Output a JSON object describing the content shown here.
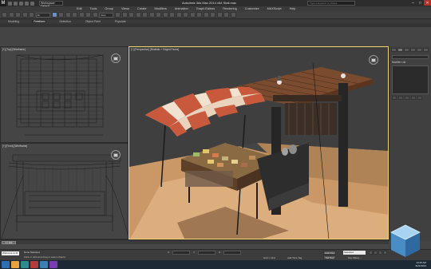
{
  "titlebar": {
    "app_title": "Autodesk 3ds Max  2014 x64      Stall.max",
    "workspace": "Workspace: Default",
    "search_placeholder": "Type a keyword or phrase",
    "min": "–",
    "max": "□",
    "close": "✕"
  },
  "menu": [
    "Edit",
    "Tools",
    "Group",
    "Views",
    "Create",
    "Modifiers",
    "Animation",
    "Graph Editors",
    "Rendering",
    "Customize",
    "MAXScript",
    "Help"
  ],
  "toolbar": {
    "selection_filter": "All",
    "view_dropdown": "View"
  },
  "ribbon": {
    "tabs": [
      "Modeling",
      "Freeform",
      "Selection",
      "Object Paint",
      "Populate"
    ]
  },
  "viewports": {
    "top_label": "[+] [Top] [Wireframe]",
    "front_label": "[+] [Front] [Wireframe]",
    "persp_label": "[+] [Perspective] [Realistic + Edged Faces]"
  },
  "command_panel": {
    "section_label": "Modifier List"
  },
  "timeline": {
    "slider_text": "0 / 100"
  },
  "status": {
    "maxscript": "Welcome to M",
    "message": "None Selected",
    "prompt": "Click or click-and-drag to select objects",
    "x_label": "X:",
    "y_label": "Y:",
    "z_label": "Z:",
    "grid": "Grid = 10.0",
    "add_time_tag": "Add Time Tag",
    "auto_key": "Auto Key",
    "set_key": "Set Key",
    "selected": "Selected",
    "key_filters": "Key Filters..."
  },
  "taskbar": {
    "time": "10:45 AM",
    "date": "6/21/2013"
  },
  "colors": {
    "accent_active_viewport": "#f2d36c",
    "awning_red": "#c9593d",
    "awning_cream": "#f1e1cf",
    "floor": "#d9a877"
  }
}
